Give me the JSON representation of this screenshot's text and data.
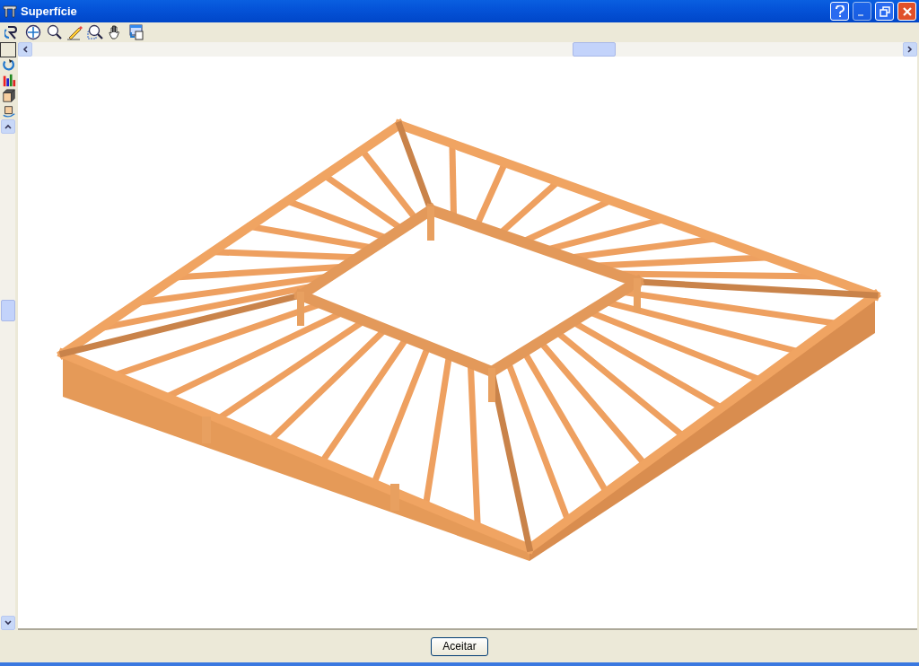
{
  "window": {
    "title": "Superfície"
  },
  "footer": {
    "button": "Aceitar"
  }
}
